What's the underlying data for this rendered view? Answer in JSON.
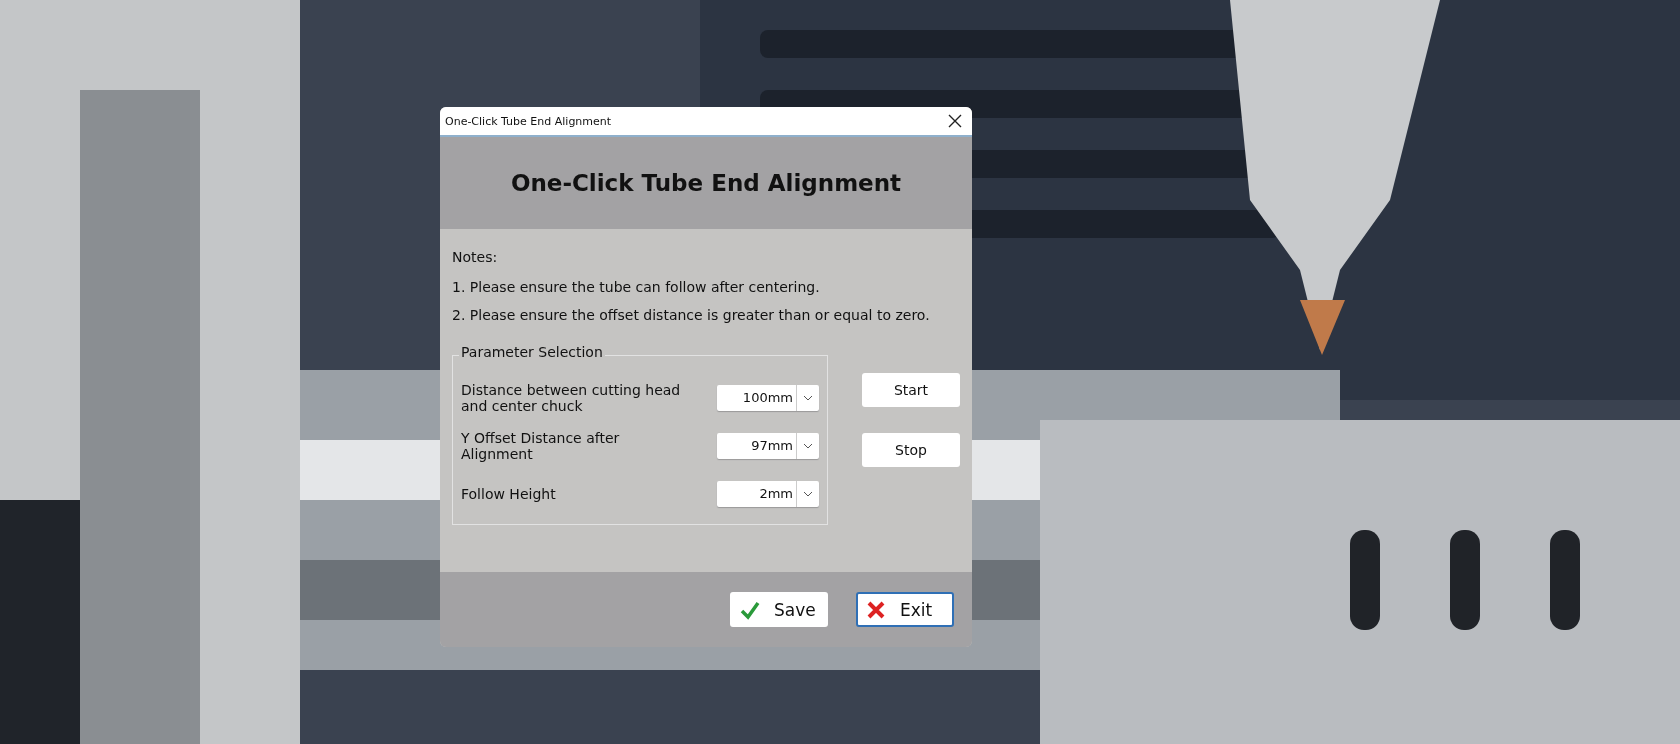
{
  "window": {
    "title": "One-Click Tube End Alignment"
  },
  "heading": "One-Click Tube End Alignment",
  "notes": {
    "label": "Notes:",
    "items": [
      "1. Please ensure the tube can follow after centering.",
      "2. Please ensure the offset distance is greater than or equal to zero."
    ]
  },
  "parameter_group": {
    "title": "Parameter Selection",
    "fields": [
      {
        "label": "Distance between cutting head and center chuck",
        "value": "100mm"
      },
      {
        "label": "Y Offset Distance after Alignment",
        "value": "97mm"
      },
      {
        "label": "Follow Height",
        "value": "2mm"
      }
    ]
  },
  "side_buttons": [
    "Start",
    "Stop"
  ],
  "footer_buttons": [
    {
      "kind": "save",
      "label": "Save",
      "focused": false
    },
    {
      "kind": "exit",
      "label": "Exit",
      "focused": true
    }
  ]
}
